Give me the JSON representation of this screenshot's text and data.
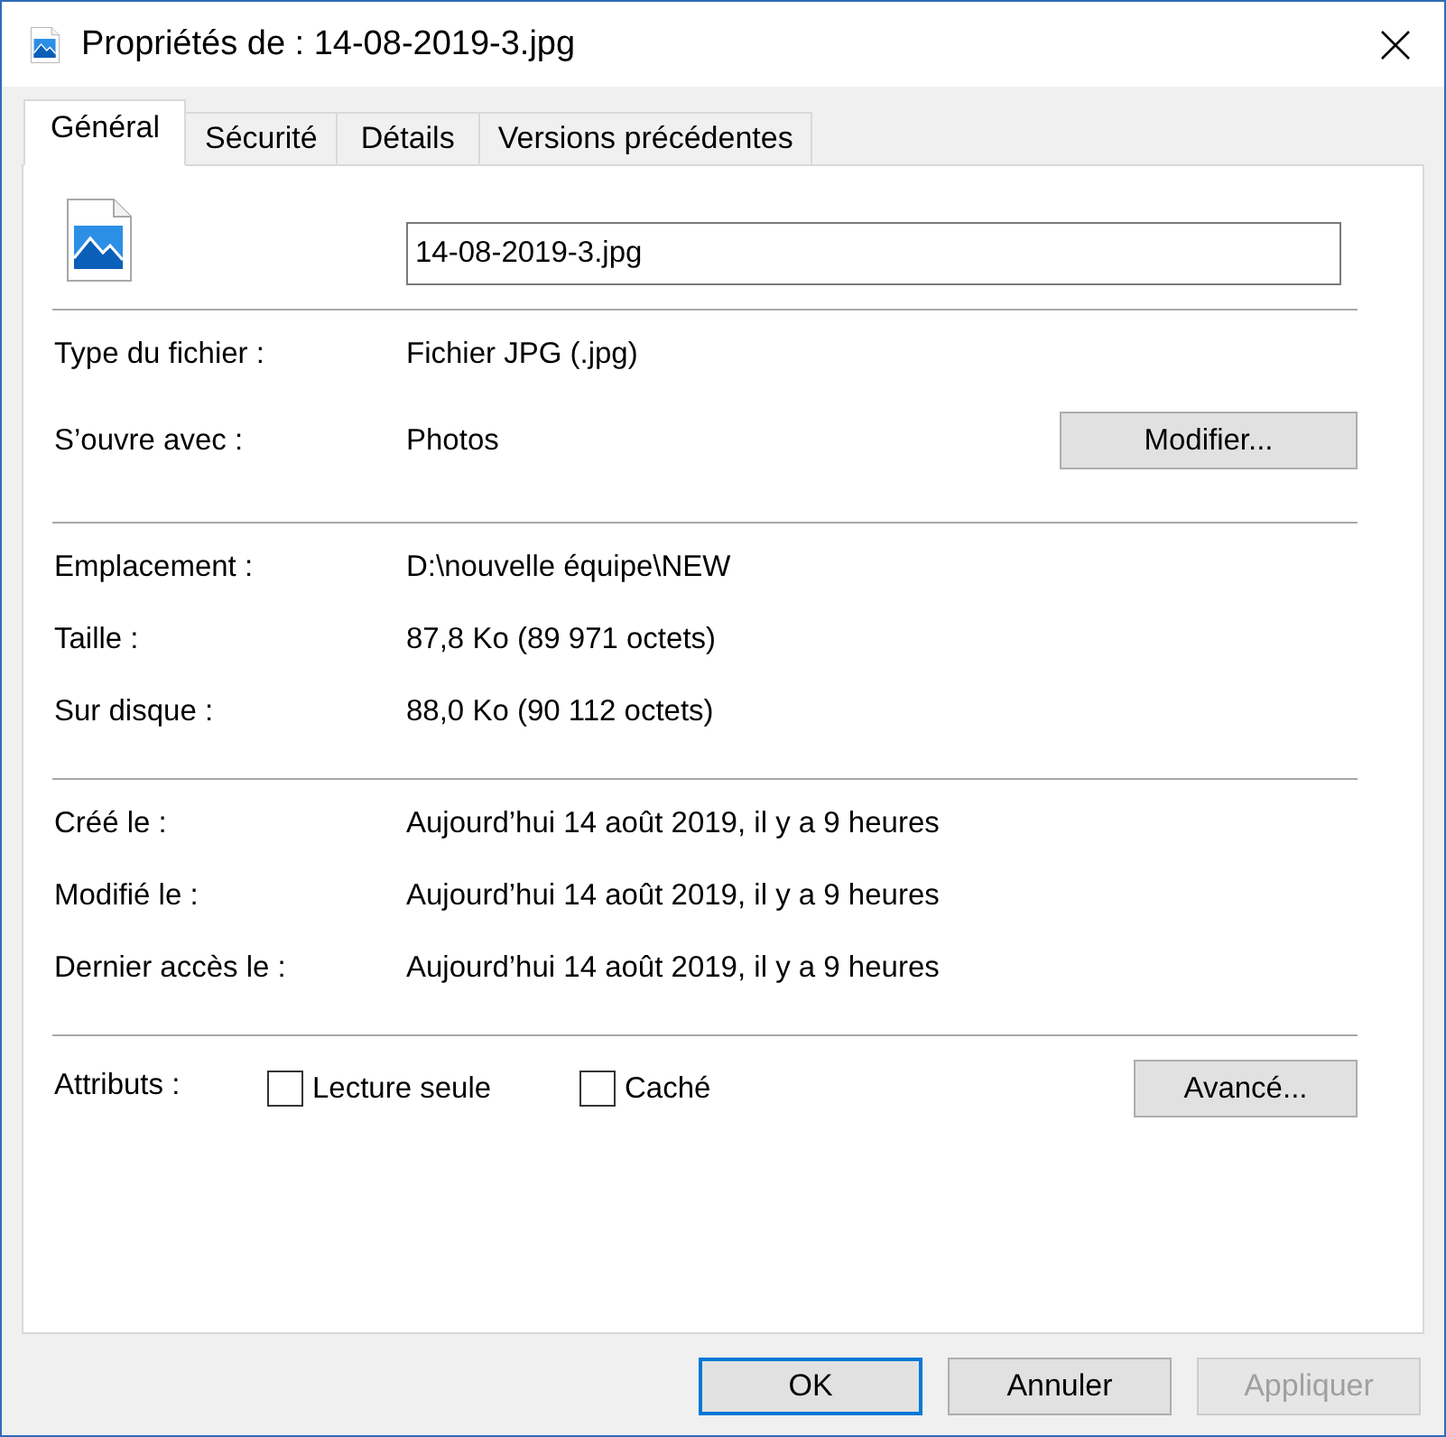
{
  "window": {
    "title": "Propriétés de : 14-08-2019-3.jpg"
  },
  "tabs": [
    {
      "label": "Général",
      "selected": true
    },
    {
      "label": "Sécurité",
      "selected": false
    },
    {
      "label": "Détails",
      "selected": false
    },
    {
      "label": "Versions précédentes",
      "selected": false
    }
  ],
  "file_name": {
    "value": "14-08-2019-3.jpg"
  },
  "sections": [
    {
      "rows": [
        {
          "label": "Type du fichier :",
          "value": "Fichier JPG (.jpg)"
        },
        {
          "label": "S’ouvre avec :",
          "value": "Photos",
          "button": "Modifier..."
        }
      ]
    },
    {
      "rows": [
        {
          "label": "Emplacement :",
          "value": "D:\\nouvelle équipe\\NEW"
        },
        {
          "label": "Taille :",
          "value": "87,8 Ko (89 971 octets)"
        },
        {
          "label": "Sur disque :",
          "value": "88,0 Ko (90 112 octets)"
        }
      ]
    },
    {
      "rows": [
        {
          "label": "Créé le :",
          "value": "Aujourd’hui 14 août 2019, il y a 9 heures"
        },
        {
          "label": "Modifié le :",
          "value": "Aujourd’hui 14 août 2019, il y a 9 heures"
        },
        {
          "label": "Dernier accès le :",
          "value": "Aujourd’hui 14 août 2019, il y a 9 heures"
        }
      ]
    }
  ],
  "attributes": {
    "label": "Attributs :",
    "checkboxes": [
      {
        "label": "Lecture seule",
        "checked": false
      },
      {
        "label": "Caché",
        "checked": false
      }
    ],
    "button": "Avancé..."
  },
  "buttons": [
    {
      "label": "OK",
      "default": true,
      "disabled": false
    },
    {
      "label": "Annuler",
      "default": false,
      "disabled": false
    },
    {
      "label": "Appliquer",
      "default": false,
      "disabled": true
    }
  ]
}
